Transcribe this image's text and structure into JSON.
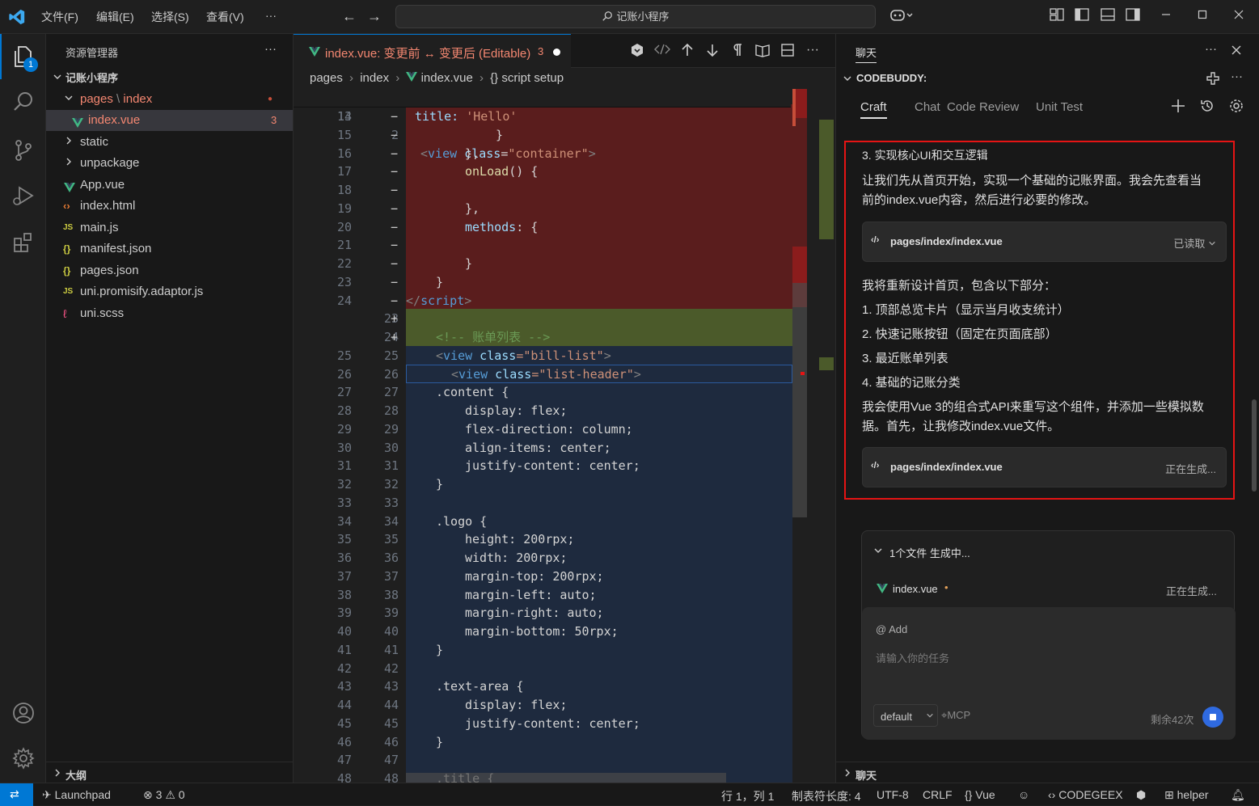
{
  "titlebar": {
    "menus": [
      "文件(F)",
      "编辑(E)",
      "选择(S)",
      "查看(V)",
      "···"
    ],
    "search_text": "记账小程序"
  },
  "activitybar": {
    "explorer_badge": "1"
  },
  "sidebar": {
    "title": "资源管理器",
    "more": "···",
    "project": "记账小程序",
    "folder_pages": "pages",
    "folder_index": "index",
    "pages_dot": "●",
    "selected_file": "index.vue",
    "selected_badge": "3",
    "items": [
      "static",
      "unpackage",
      "App.vue",
      "index.html",
      "main.js",
      "manifest.json",
      "pages.json",
      "uni.promisify.adaptor.js",
      "uni.scss"
    ],
    "outline": "大纲"
  },
  "editor": {
    "tab_label": "index.vue: 变更前 ↔ 变更后 (Editable)",
    "tab_badge": "3",
    "more": "···",
    "breadcrumb": [
      "pages",
      "index",
      "index.vue",
      "{} script setup"
    ],
    "sticky": {
      "ln": "13",
      "ln2": "2"
    },
    "rows": [
      {
        "ln1": "14",
        "ln2": "",
        "sign": "−",
        "type": "del"
      },
      {
        "ln1": "15",
        "ln2": "",
        "sign": "−",
        "type": "del"
      },
      {
        "ln1": "16",
        "ln2": "",
        "sign": "−",
        "type": "del"
      },
      {
        "ln1": "17",
        "ln2": "",
        "sign": "−",
        "type": "del"
      },
      {
        "ln1": "18",
        "ln2": "",
        "sign": "−",
        "type": "del"
      },
      {
        "ln1": "19",
        "ln2": "",
        "sign": "−",
        "type": "del"
      },
      {
        "ln1": "20",
        "ln2": "",
        "sign": "−",
        "type": "del"
      },
      {
        "ln1": "21",
        "ln2": "",
        "sign": "−",
        "type": "del"
      },
      {
        "ln1": "22",
        "ln2": "",
        "sign": "−",
        "type": "del"
      },
      {
        "ln1": "23",
        "ln2": "",
        "sign": "−",
        "type": "del"
      },
      {
        "ln1": "24",
        "ln2": "",
        "sign": "−",
        "type": "del"
      },
      {
        "ln1": "",
        "ln2": "23",
        "sign": "+",
        "type": "ins"
      },
      {
        "ln1": "",
        "ln2": "24",
        "sign": "+",
        "type": "ins"
      },
      {
        "ln1": "25",
        "ln2": "25",
        "sign": "",
        "type": "ctx"
      },
      {
        "ln1": "26",
        "ln2": "26",
        "sign": "",
        "type": "ctx"
      },
      {
        "ln1": "27",
        "ln2": "27",
        "sign": "",
        "type": "ctx"
      },
      {
        "ln1": "28",
        "ln2": "28",
        "sign": "",
        "type": "ctx"
      },
      {
        "ln1": "29",
        "ln2": "29",
        "sign": "",
        "type": "ctx"
      },
      {
        "ln1": "30",
        "ln2": "30",
        "sign": "",
        "type": "ctx"
      },
      {
        "ln1": "31",
        "ln2": "31",
        "sign": "",
        "type": "ctx"
      },
      {
        "ln1": "32",
        "ln2": "32",
        "sign": "",
        "type": "ctx"
      },
      {
        "ln1": "33",
        "ln2": "33",
        "sign": "",
        "type": "ctx"
      },
      {
        "ln1": "34",
        "ln2": "34",
        "sign": "",
        "type": "ctx"
      },
      {
        "ln1": "35",
        "ln2": "35",
        "sign": "",
        "type": "ctx"
      },
      {
        "ln1": "36",
        "ln2": "36",
        "sign": "",
        "type": "ctx"
      },
      {
        "ln1": "37",
        "ln2": "37",
        "sign": "",
        "type": "ctx"
      },
      {
        "ln1": "38",
        "ln2": "38",
        "sign": "",
        "type": "ctx"
      },
      {
        "ln1": "39",
        "ln2": "39",
        "sign": "",
        "type": "ctx"
      },
      {
        "ln1": "40",
        "ln2": "40",
        "sign": "",
        "type": "ctx"
      },
      {
        "ln1": "41",
        "ln2": "41",
        "sign": "",
        "type": "ctx"
      },
      {
        "ln1": "42",
        "ln2": "42",
        "sign": "",
        "type": "ctx"
      },
      {
        "ln1": "43",
        "ln2": "43",
        "sign": "",
        "type": "ctx"
      },
      {
        "ln1": "44",
        "ln2": "44",
        "sign": "",
        "type": "ctx"
      },
      {
        "ln1": "45",
        "ln2": "45",
        "sign": "",
        "type": "ctx"
      },
      {
        "ln1": "46",
        "ln2": "46",
        "sign": "",
        "type": "ctx"
      },
      {
        "ln1": "47",
        "ln2": "47",
        "sign": "",
        "type": "ctx"
      },
      {
        "ln1": "48",
        "ln2": "48",
        "sign": "",
        "type": "ctx"
      }
    ],
    "code": {
      "l0_tag_open": "<",
      "l0_view": "view",
      "l0_attr": "class",
      "l0_eq": "=",
      "l0_val": "\"container\"",
      "l0_close": ">",
      "l14_key": "title: ",
      "l14_val": "'Hello'",
      "l15": "}",
      "l16": "},",
      "l17_fn": "onLoad",
      "l17_rest": "() {",
      "l18": "",
      "l19": "},",
      "l20_key": "methods",
      "l20_rest": ": {",
      "l21": "",
      "l22": "}",
      "l23": "}",
      "l24_open": "</",
      "l24_tag": "script",
      "l24_close": ">",
      "i1": "",
      "i2": "<!-- 账单列表 -->",
      "c25_o": "<",
      "c25_t": "view",
      "c25_a": " class",
      "c25_v": "=\"bill-list\"",
      "c25_c": ">",
      "c26_o": "<",
      "c26_t": "view",
      "c26_a": " class",
      "c26_v": "=\"list-header\"",
      "c26_c": ">",
      "c27": ".content {",
      "c28": "display: flex;",
      "c29": "flex-direction: column;",
      "c30": "align-items: center;",
      "c31": "justify-content: center;",
      "c32": "}",
      "c33": "",
      "c34": ".logo {",
      "c35": "height: 200rpx;",
      "c36": "width: 200rpx;",
      "c37": "margin-top: 200rpx;",
      "c38": "margin-left: auto;",
      "c39": "margin-right: auto;",
      "c40": "margin-bottom: 50rpx;",
      "c41": "}",
      "c42": "",
      "c43": ".text-area {",
      "c44": "display: flex;",
      "c45": "justify-content: center;",
      "c46": "}",
      "c47": "",
      "c48": ".title {"
    }
  },
  "chat": {
    "header_title": "聊天",
    "more": "···",
    "section": "CODEBUDDY:",
    "tabs": [
      "Craft",
      "Chat",
      "Code Review",
      "Unit Test"
    ],
    "msg": {
      "step": "3. 实现核心UI和交互逻辑",
      "p1a": "让我们先从首页开始，实现一个基础的记账界面。我会先查看当",
      "p1b": "前的index.vue内容，然后进行必要的修改。",
      "card1_file": "pages/index/index.vue",
      "card1_status": "已读取",
      "p2": "我将重新设计首页，包含以下部分：",
      "li1": "1. 顶部总览卡片（显示当月收支统计）",
      "li2": "2. 快速记账按钮（固定在页面底部）",
      "li3": "3. 最近账单列表",
      "li4": "4. 基础的记账分类",
      "p3a": "我会使用Vue 3的组合式API来重写这个组件，并添加一些模拟数",
      "p3b": "据。首先，让我修改index.vue文件。",
      "card2_file": "pages/index/index.vue",
      "card2_status": "正在生成..."
    },
    "gen": {
      "title": "1个文件 生成中...",
      "file": "index.vue",
      "dot": "•",
      "status": "正在生成..."
    },
    "input": {
      "add": "@ Add",
      "placeholder": "请输入你的任务",
      "model": "default",
      "mcp": "MCP",
      "remaining": "剩余42次"
    },
    "footer": "聊天"
  },
  "statusbar": {
    "launchpad": "Launchpad",
    "errors": "3",
    "warnings": "0",
    "position": "行 1，列 1",
    "tab_size": "制表符长度: 4",
    "encoding": "UTF-8",
    "eol": "CRLF",
    "language": "Vue",
    "codegeex": "CODEGEEX",
    "helper": "helper"
  },
  "colors": {
    "accent": "#0078d4",
    "deleted": "#5a1d1d",
    "inserted": "#4b5a2a",
    "highlight_border": "#e51414",
    "vue_green": "#41b883"
  }
}
